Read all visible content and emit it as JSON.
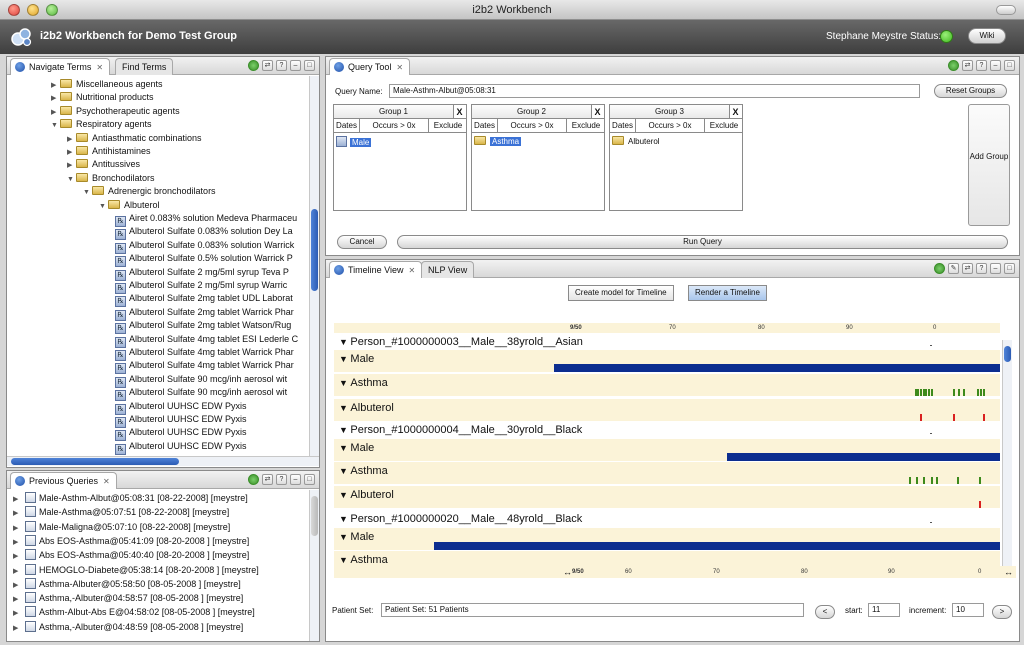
{
  "window": {
    "title": "i2b2 Workbench"
  },
  "banner": {
    "app_title": "i2b2 Workbench for Demo Test Group",
    "user": "Stephane Meystre",
    "status_label": "Status:",
    "status_color": "#3fb81e",
    "wiki_label": "Wiki"
  },
  "navigate": {
    "tabs": [
      "Navigate Terms",
      "Find Terms"
    ],
    "tree": [
      {
        "label": "Miscellaneous agents",
        "level": 0,
        "state": "collapsed",
        "kind": "folder"
      },
      {
        "label": "Nutritional products",
        "level": 0,
        "state": "collapsed",
        "kind": "folder"
      },
      {
        "label": "Psychotherapeutic agents",
        "level": 0,
        "state": "collapsed",
        "kind": "folder"
      },
      {
        "label": "Respiratory agents",
        "level": 0,
        "state": "expanded",
        "kind": "folder"
      },
      {
        "label": "Antiasthmatic combinations",
        "level": 1,
        "state": "collapsed",
        "kind": "folder"
      },
      {
        "label": "Antihistamines",
        "level": 1,
        "state": "collapsed",
        "kind": "folder"
      },
      {
        "label": "Antitussives",
        "level": 1,
        "state": "collapsed",
        "kind": "folder"
      },
      {
        "label": "Bronchodilators",
        "level": 1,
        "state": "expanded",
        "kind": "folder"
      },
      {
        "label": "Adrenergic bronchodilators",
        "level": 2,
        "state": "expanded",
        "kind": "folder"
      },
      {
        "label": "Albuterol",
        "level": 3,
        "state": "expanded",
        "kind": "folder"
      },
      {
        "label": "Airet 0.083% solution Medeva Pharmaceu",
        "level": 4,
        "kind": "leaf"
      },
      {
        "label": "Albuterol Sulfate 0.083% solution Dey La",
        "level": 4,
        "kind": "leaf"
      },
      {
        "label": "Albuterol Sulfate 0.083% solution Warrick",
        "level": 4,
        "kind": "leaf"
      },
      {
        "label": "Albuterol Sulfate 0.5% solution Warrick P",
        "level": 4,
        "kind": "leaf"
      },
      {
        "label": "Albuterol Sulfate 2 mg/5ml syrup Teva P",
        "level": 4,
        "kind": "leaf"
      },
      {
        "label": "Albuterol Sulfate 2 mg/5ml syrup Warric",
        "level": 4,
        "kind": "leaf"
      },
      {
        "label": "Albuterol Sulfate 2mg tablet UDL Laborat",
        "level": 4,
        "kind": "leaf"
      },
      {
        "label": "Albuterol Sulfate 2mg tablet Warrick Phar",
        "level": 4,
        "kind": "leaf"
      },
      {
        "label": "Albuterol Sulfate 2mg tablet Watson/Rug",
        "level": 4,
        "kind": "leaf"
      },
      {
        "label": "Albuterol Sulfate 4mg tablet ESI Lederle C",
        "level": 4,
        "kind": "leaf"
      },
      {
        "label": "Albuterol Sulfate 4mg tablet Warrick Phar",
        "level": 4,
        "kind": "leaf"
      },
      {
        "label": "Albuterol Sulfate 4mg tablet Warrick Phar",
        "level": 4,
        "kind": "leaf"
      },
      {
        "label": "Albuterol Sulfate 90 mcg/inh aerosol wit",
        "level": 4,
        "kind": "leaf"
      },
      {
        "label": "Albuterol Sulfate 90 mcg/inh aerosol wit",
        "level": 4,
        "kind": "leaf"
      },
      {
        "label": "Albuterol UUHSC EDW Pyxis",
        "level": 4,
        "kind": "leaf"
      },
      {
        "label": "Albuterol UUHSC EDW Pyxis",
        "level": 4,
        "kind": "leaf"
      },
      {
        "label": "Albuterol UUHSC EDW Pyxis",
        "level": 4,
        "kind": "leaf"
      },
      {
        "label": "Albuterol UUHSC EDW Pyxis",
        "level": 4,
        "kind": "leaf"
      }
    ]
  },
  "previous_queries": {
    "tab": "Previous Queries",
    "items": [
      "Male-Asthm-Albut@05:08:31 [08-22-2008] [meystre]",
      "Male-Asthma@05:07:51 [08-22-2008] [meystre]",
      "Male-Maligna@05:07:10 [08-22-2008] [meystre]",
      "Abs EOS-Asthma@05:41:09 [08-20-2008 ] [meystre]",
      "Abs EOS-Asthma@05:40:40 [08-20-2008 ] [meystre]",
      "HEMOGLO-Diabete@05:38:14 [08-20-2008 ] [meystre]",
      "Asthma-Albuter@05:58:50 [08-05-2008 ] [meystre]",
      "Asthma,-Albuter@04:58:57 [08-05-2008 ] [meystre]",
      "Asthm-Albut-Abs E@04:58:02 [08-05-2008 ] [meystre]",
      "Asthma,-Albuter@04:48:59 [08-05-2008 ] [meystre]"
    ]
  },
  "query_tool": {
    "tab": "Query Tool",
    "name_label": "Query Name:",
    "name_value": "Male-Asthm-Albut@05:08:31",
    "reset_label": "Reset Groups",
    "add_group_label": "Add Group",
    "cancel_label": "Cancel",
    "run_label": "Run Query",
    "opt_dates": "Dates",
    "opt_occurs": "Occurs > 0x",
    "opt_exclude": "Exclude",
    "close_x": "X",
    "groups": [
      {
        "title": "Group 1",
        "item": "Male",
        "selected": true
      },
      {
        "title": "Group 2",
        "item": "Asthma",
        "selected": true
      },
      {
        "title": "Group 3",
        "item": "Albuterol",
        "selected": false
      }
    ]
  },
  "timeline": {
    "tabs": [
      "Timeline View",
      "NLP View"
    ],
    "create_label": "Create model for Timeline",
    "render_label": "Render a Timeline",
    "top_ticks": [
      "9/50",
      "70",
      "80",
      "90",
      "0"
    ],
    "bottom_ticks": [
      "9/50",
      "60",
      "70",
      "80",
      "90",
      "0"
    ],
    "rows": [
      {
        "label": "Person_#1000000003__Male__38yrold__Asian",
        "kind": "person"
      },
      {
        "label": "Male",
        "kind": "concept",
        "bar_start": 0.33,
        "bar_end": 1.0
      },
      {
        "label": "Asthma",
        "kind": "concept",
        "marks": [
          0.872,
          0.876,
          0.88,
          0.884,
          0.888,
          0.892,
          0.896,
          0.93,
          0.937,
          0.944,
          0.965,
          0.97,
          0.975
        ],
        "mark_color": "#3d8a1c"
      },
      {
        "label": "Albuterol",
        "kind": "concept",
        "marks": [
          0.88,
          0.93,
          0.975
        ],
        "mark_color": "#d92020"
      },
      {
        "label": "Person_#1000000004__Male__30yrold__Black",
        "kind": "person"
      },
      {
        "label": "Male",
        "kind": "concept",
        "bar_start": 0.59,
        "bar_end": 1.0
      },
      {
        "label": "Asthma",
        "kind": "concept",
        "marks": [
          0.864,
          0.874,
          0.885,
          0.896,
          0.904,
          0.935,
          0.968
        ],
        "mark_color": "#3d8a1c"
      },
      {
        "label": "Albuterol",
        "kind": "concept",
        "marks": [
          0.968
        ],
        "mark_color": "#d92020"
      },
      {
        "label": "Person_#1000000020__Male__48yrold__Black",
        "kind": "person"
      },
      {
        "label": "Male",
        "kind": "concept",
        "bar_start": 0.15,
        "bar_end": 1.0
      },
      {
        "label": "Asthma",
        "kind": "concept"
      }
    ],
    "patient_set_label": "Patient Set:",
    "patient_set_value": "Patient Set: 51 Patients",
    "prev_label": "<",
    "next_label": ">",
    "start_label": "start:",
    "start_value": "11",
    "increment_label": "increment:",
    "increment_value": "10"
  }
}
